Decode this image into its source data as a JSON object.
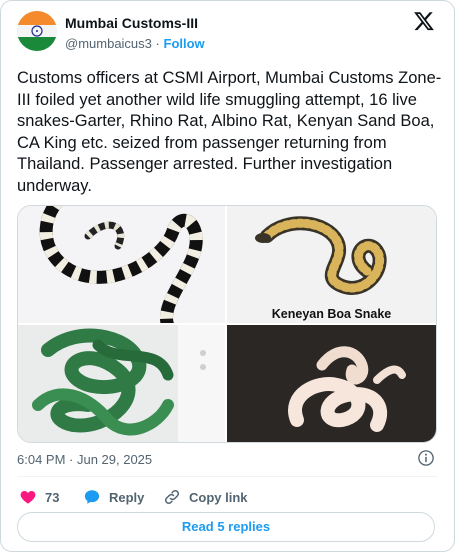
{
  "author": {
    "name": "Mumbai Customs-III",
    "handle": "@mumbaicus3",
    "separator": "·",
    "follow_label": "Follow"
  },
  "tweet": {
    "text": "Customs officers at CSMI Airport, Mumbai Customs Zone-III foiled yet another wild life smuggling attempt, 16 live snakes-Garter, Rhino Rat, Albino Rat, Kenyan Sand Boa, CA King etc. seized from passenger returning from Thailand. Passenger arrested. Further investigation underway."
  },
  "media": {
    "image_2_caption": "Keneyan Boa Snake"
  },
  "meta": {
    "timestamp": "6:04 PM · Jun 29, 2025"
  },
  "actions": {
    "like_count": "73",
    "reply_label": "Reply",
    "copy_link_label": "Copy link"
  },
  "replies_button": "Read 5 replies",
  "colors": {
    "accent": "#1d9bf0",
    "like": "#f91880",
    "text": "#0f1419",
    "secondary": "#536471"
  },
  "icons": [
    "india-flag-avatar",
    "x-logo-icon",
    "info-icon",
    "heart-icon",
    "reply-bubble-icon",
    "copy-link-icon"
  ]
}
